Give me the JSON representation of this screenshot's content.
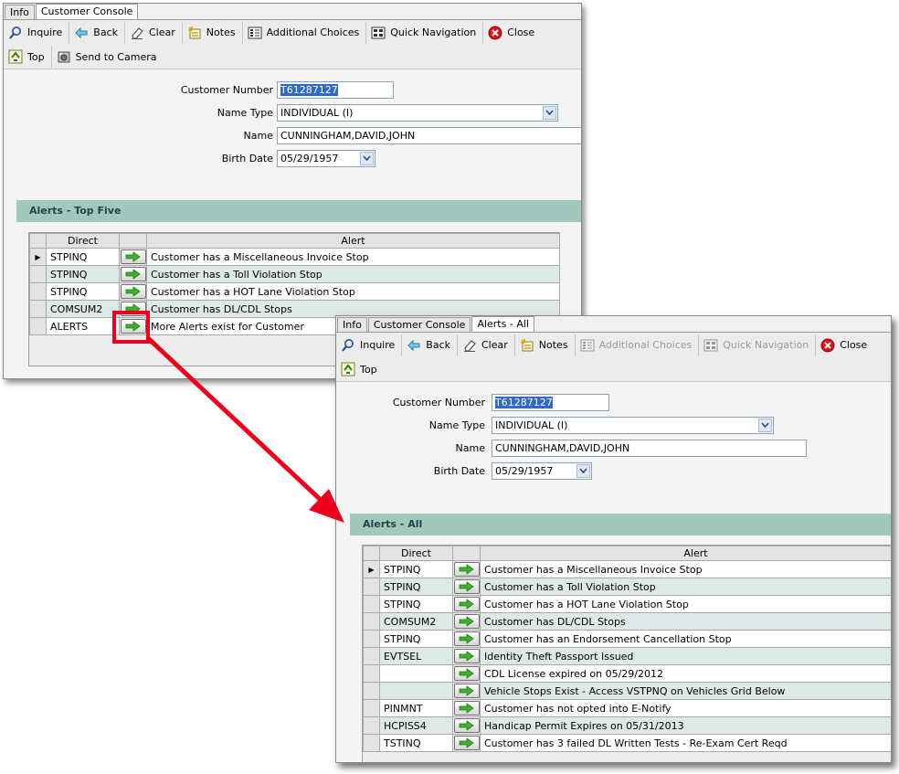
{
  "window1": {
    "tabs": [
      "Info",
      "Customer Console"
    ],
    "active_tab": 1,
    "toolbar_row1": [
      {
        "label": "Inquire",
        "icon": "search-icon"
      },
      {
        "label": "Back",
        "icon": "back-arrow-icon"
      },
      {
        "label": "Clear",
        "icon": "eraser-icon"
      },
      {
        "label": "Notes",
        "icon": "notes-icon"
      },
      {
        "label": "Additional Choices",
        "icon": "choices-icon"
      },
      {
        "label": "Quick Navigation",
        "icon": "navigation-icon"
      },
      {
        "label": "Close",
        "icon": "close-icon"
      }
    ],
    "toolbar_row2": [
      {
        "label": "Top",
        "icon": "top-icon"
      },
      {
        "label": "Send to Camera",
        "icon": "camera-icon"
      }
    ],
    "form": {
      "customer_number_label": "Customer Number",
      "customer_number": "T61287127",
      "name_type_label": "Name Type",
      "name_type": "INDIVIDUAL (I)",
      "name_label": "Name",
      "name": "CUNNINGHAM,DAVID,JOHN",
      "birth_date_label": "Birth Date",
      "birth_date": "05/29/1957"
    },
    "section_title": "Alerts - Top Five",
    "columns": [
      "Direct",
      "Alert"
    ],
    "rows": [
      {
        "direct": "STPINQ",
        "alert": "Customer has a Miscellaneous Invoice Stop"
      },
      {
        "direct": "STPINQ",
        "alert": "Customer has a Toll Violation Stop"
      },
      {
        "direct": "STPINQ",
        "alert": "Customer has a HOT Lane Violation Stop"
      },
      {
        "direct": "COMSUM2",
        "alert": "Customer has DL/CDL Stops"
      },
      {
        "direct": "ALERTS",
        "alert": "More Alerts exist for Customer"
      }
    ]
  },
  "window2": {
    "tabs": [
      "Info",
      "Customer Console",
      "Alerts - All"
    ],
    "active_tab": 2,
    "toolbar_row1": [
      {
        "label": "Inquire",
        "icon": "search-icon",
        "disabled": false
      },
      {
        "label": "Back",
        "icon": "back-arrow-icon",
        "disabled": false
      },
      {
        "label": "Clear",
        "icon": "eraser-icon",
        "disabled": false
      },
      {
        "label": "Notes",
        "icon": "notes-icon",
        "disabled": false
      },
      {
        "label": "Additional Choices",
        "icon": "choices-icon",
        "disabled": true
      },
      {
        "label": "Quick Navigation",
        "icon": "navigation-icon",
        "disabled": true
      },
      {
        "label": "Close",
        "icon": "close-icon",
        "disabled": false
      }
    ],
    "toolbar_row2": [
      {
        "label": "Top",
        "icon": "top-icon"
      }
    ],
    "form": {
      "customer_number_label": "Customer Number",
      "customer_number": "T61287127",
      "name_type_label": "Name Type",
      "name_type": "INDIVIDUAL (I)",
      "name_label": "Name",
      "name": "CUNNINGHAM,DAVID,JOHN",
      "birth_date_label": "Birth Date",
      "birth_date": "05/29/1957"
    },
    "section_title": "Alerts - All",
    "columns": [
      "Direct",
      "Alert"
    ],
    "rows": [
      {
        "direct": "STPINQ",
        "alert": "Customer has a Miscellaneous Invoice Stop"
      },
      {
        "direct": "STPINQ",
        "alert": "Customer has a Toll Violation Stop"
      },
      {
        "direct": "STPINQ",
        "alert": "Customer has a HOT Lane Violation Stop"
      },
      {
        "direct": "COMSUM2",
        "alert": "Customer has DL/CDL Stops"
      },
      {
        "direct": "STPINQ",
        "alert": "Customer has  an Endorsement Cancellation Stop"
      },
      {
        "direct": "EVTSEL",
        "alert": "Identity Theft Passport Issued"
      },
      {
        "direct": "",
        "alert": "CDL License expired on 05/29/2012"
      },
      {
        "direct": "",
        "alert": "Vehicle Stops Exist - Access VSTPNQ on Vehicles Grid Below"
      },
      {
        "direct": "PINMNT",
        "alert": "Customer has not opted into E-Notify"
      },
      {
        "direct": "HCPISS4",
        "alert": "Handicap Permit Expires on 05/31/2013"
      },
      {
        "direct": "TSTINQ",
        "alert": "Customer has 3 failed DL Written Tests - Re-Exam Cert Reqd"
      }
    ]
  },
  "colors": {
    "section_header": "#a2c7bd",
    "alt_row": "#dde9e6",
    "callout_red": "#e8001c",
    "selection": "#3169c6"
  }
}
